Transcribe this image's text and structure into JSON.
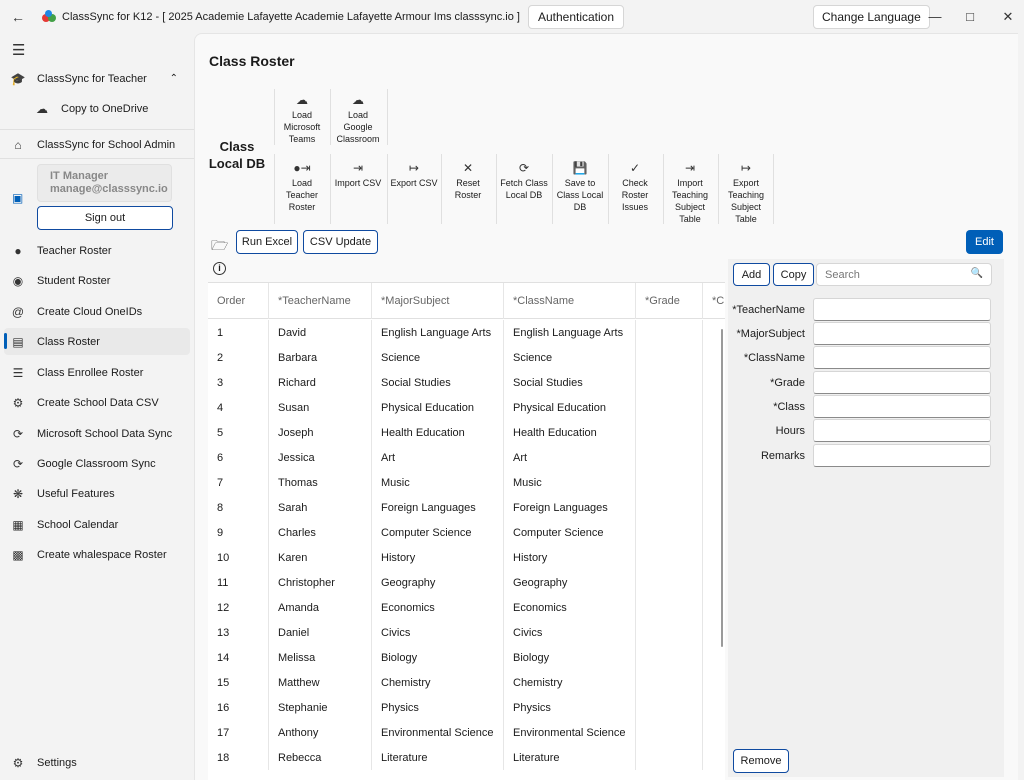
{
  "titlebar": {
    "title": "ClassSync for K12 - [ 2025 Academie Lafayette Academie Lafayette Armour Ims classsync.io ]",
    "auth_label": "Authentication",
    "lang_label": "Change Language",
    "logo_colors": [
      "#e53935",
      "#43a047",
      "#1e88e5"
    ]
  },
  "sidebar": {
    "teacher_group": "ClassSync for Teacher",
    "copy_onedrive": "Copy to OneDrive",
    "school_admin": "ClassSync for School Admin",
    "user_role": "IT Manager",
    "user_email": "manage@classsync.io",
    "sign_out": "Sign out",
    "items": [
      {
        "label": "Teacher Roster",
        "icon": "user-icon"
      },
      {
        "label": "Student Roster",
        "icon": "student-icon"
      },
      {
        "label": "Create Cloud OneIDs",
        "icon": "at-icon"
      },
      {
        "label": "Class Roster",
        "icon": "clipboard-icon"
      },
      {
        "label": "Class Enrollee Roster",
        "icon": "list-icon"
      },
      {
        "label": "Create School Data CSV",
        "icon": "settings-icon"
      },
      {
        "label": "Microsoft School Data Sync",
        "icon": "sync-icon"
      },
      {
        "label": "Google Classroom Sync",
        "icon": "sync-icon"
      },
      {
        "label": "Useful Features",
        "icon": "bug-icon"
      },
      {
        "label": "School Calendar",
        "icon": "calendar-icon"
      },
      {
        "label": "Create whalespace Roster",
        "icon": "roster-icon"
      }
    ],
    "settings": "Settings"
  },
  "main": {
    "title": "Class Roster",
    "db_label_line1": "Class",
    "db_label_line2": "Local DB",
    "toolbar_top": [
      {
        "l1": "Load",
        "l2": "Microsoft",
        "l3": "Teams"
      },
      {
        "l1": "Load",
        "l2": "Google",
        "l3": "Classroom"
      }
    ],
    "toolbar": [
      {
        "l1": "Load",
        "l2": "Teacher",
        "l3": "Roster",
        "l4": ""
      },
      {
        "l1": "Import CSV",
        "l2": "",
        "l3": "",
        "l4": ""
      },
      {
        "l1": "Export CSV",
        "l2": "",
        "l3": "",
        "l4": ""
      },
      {
        "l1": "Reset",
        "l2": "Roster",
        "l3": "",
        "l4": ""
      },
      {
        "l1": "Fetch Class",
        "l2": "Local DB",
        "l3": "",
        "l4": ""
      },
      {
        "l1": "Save to",
        "l2": "Class Local",
        "l3": "DB",
        "l4": ""
      },
      {
        "l1": "Check",
        "l2": "Roster",
        "l3": "Issues",
        "l4": ""
      },
      {
        "l1": "Import",
        "l2": "Teaching",
        "l3": "Subject",
        "l4": "Table"
      },
      {
        "l1": "Export",
        "l2": "Teaching",
        "l3": "Subject",
        "l4": "Table"
      }
    ],
    "run_excel": "Run Excel",
    "csv_update": "CSV Update",
    "edit": "Edit",
    "accent": "#005fb8"
  },
  "table": {
    "headers": [
      "Order",
      "*TeacherName",
      "*MajorSubject",
      "*ClassName",
      "*Grade",
      "*C"
    ],
    "rows": [
      [
        "1",
        "David",
        "English Language Arts",
        "English Language Arts"
      ],
      [
        "2",
        "Barbara",
        "Science",
        "Science"
      ],
      [
        "3",
        "Richard",
        "Social Studies",
        "Social Studies"
      ],
      [
        "4",
        "Susan",
        "Physical Education",
        "Physical Education"
      ],
      [
        "5",
        "Joseph",
        "Health Education",
        "Health Education"
      ],
      [
        "6",
        "Jessica",
        "Art",
        "Art"
      ],
      [
        "7",
        "Thomas",
        "Music",
        "Music"
      ],
      [
        "8",
        "Sarah",
        "Foreign Languages",
        "Foreign Languages"
      ],
      [
        "9",
        "Charles",
        "Computer Science",
        "Computer Science"
      ],
      [
        "10",
        "Karen",
        "History",
        "History"
      ],
      [
        "11",
        "Christopher",
        "Geography",
        "Geography"
      ],
      [
        "12",
        "Amanda",
        "Economics",
        "Economics"
      ],
      [
        "13",
        "Daniel",
        "Civics",
        "Civics"
      ],
      [
        "14",
        "Melissa",
        "Biology",
        "Biology"
      ],
      [
        "15",
        "Matthew",
        "Chemistry",
        "Chemistry"
      ],
      [
        "16",
        "Stephanie",
        "Physics",
        "Physics"
      ],
      [
        "17",
        "Anthony",
        "Environmental Science",
        "Environmental Science"
      ],
      [
        "18",
        "Rebecca",
        "Literature",
        "Literature"
      ]
    ]
  },
  "panel": {
    "add": "Add",
    "copy": "Copy",
    "search_placeholder": "Search",
    "fields": [
      "*TeacherName",
      "*MajorSubject",
      "*ClassName",
      "*Grade",
      "*Class",
      "Hours",
      "Remarks"
    ],
    "remove": "Remove"
  }
}
